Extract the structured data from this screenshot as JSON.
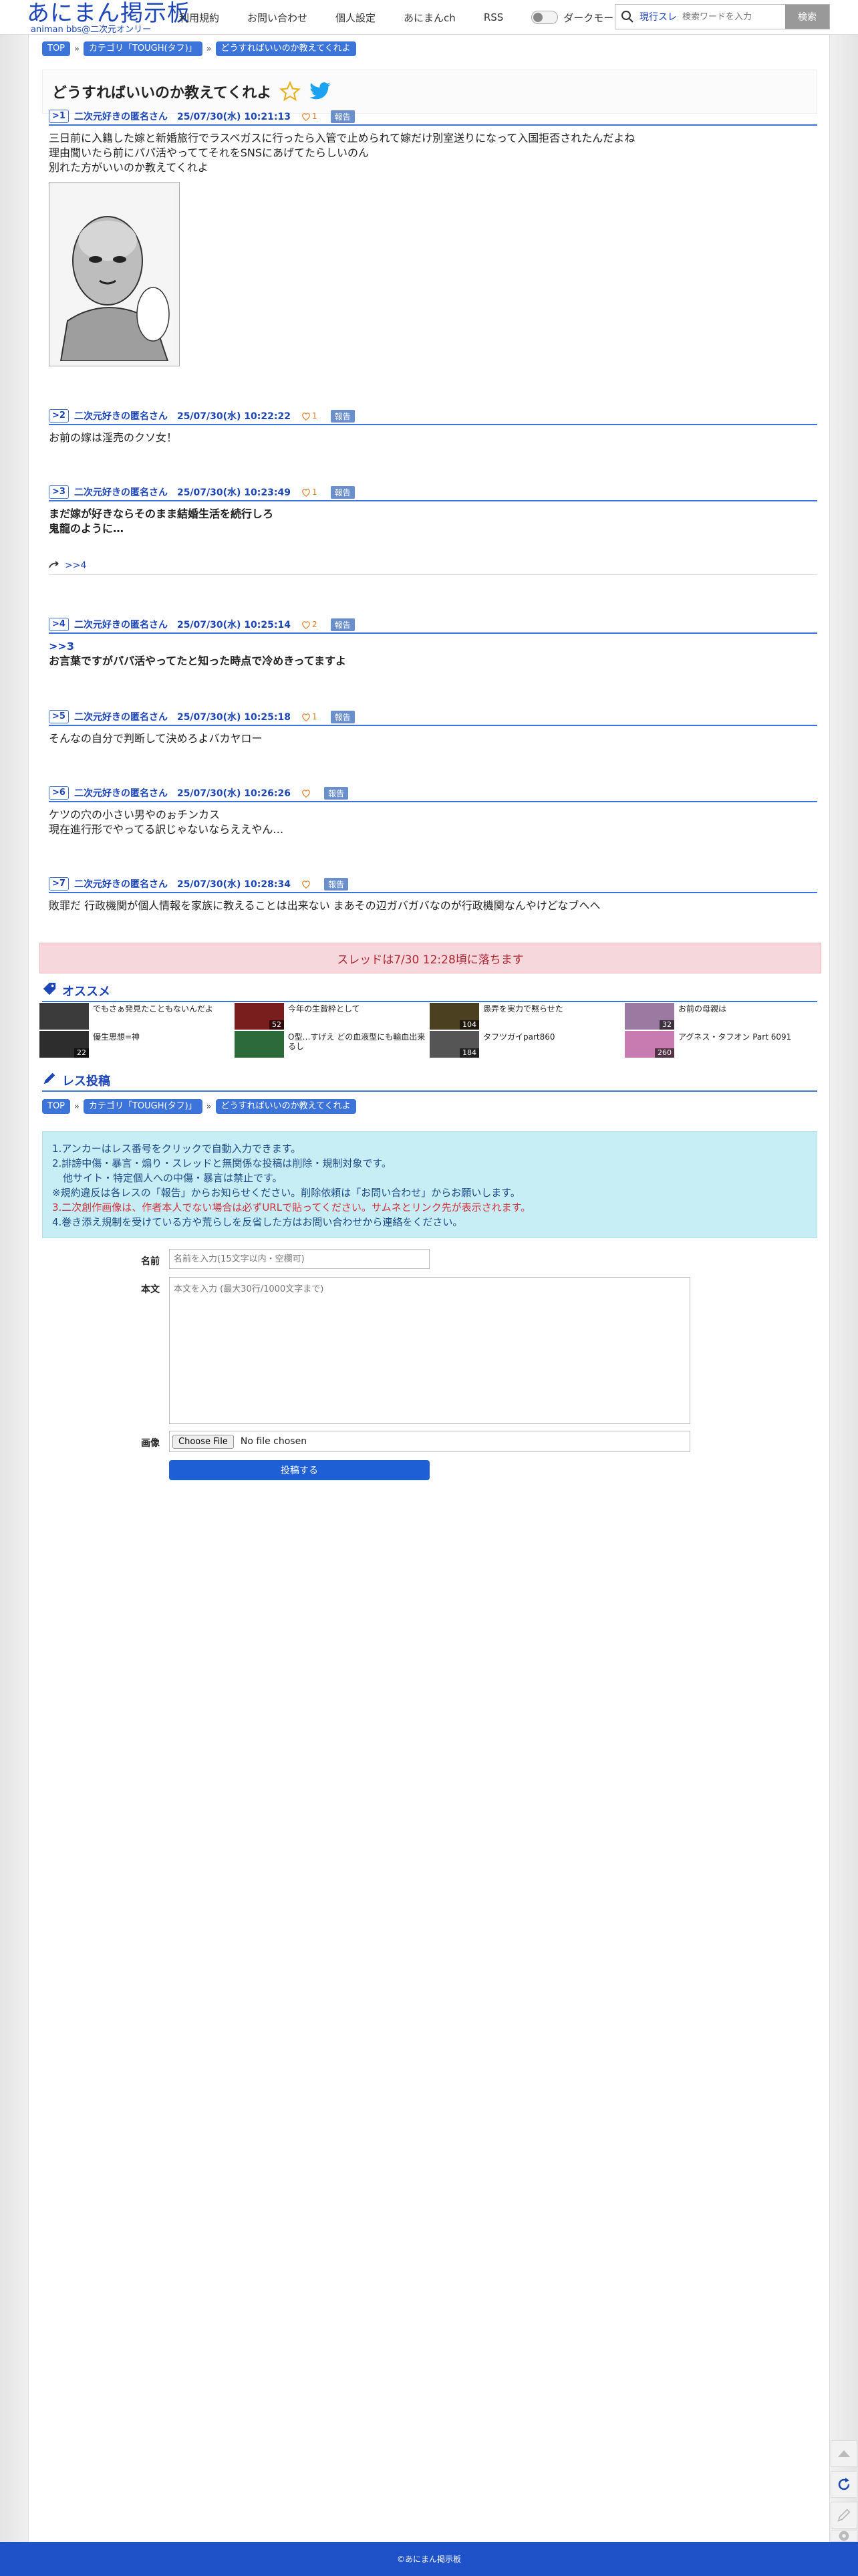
{
  "header": {
    "logo_main": "あにまん掲示板",
    "logo_sub": "animan bbs@二次元オンリー",
    "nav": [
      "利用規約",
      "お問い合わせ",
      "個人設定",
      "あにまんch",
      "RSS"
    ],
    "dark_mode_label": "ダークモード",
    "search_mode": "現行スレ",
    "search_placeholder": "検索ワードを入力",
    "search_button": "検索"
  },
  "breadcrumb": [
    "TOP",
    "カテゴリ「TOUGH(タフ)」",
    "どうすればいいのか教えてくれよ"
  ],
  "thread": {
    "title": "どうすればいいのか教えてくれよ"
  },
  "posts": [
    {
      "num": "1",
      "name": "二次元好きの匿名さん",
      "date": "25/07/30(水) 10:21:13",
      "likes": "1",
      "report": "報告",
      "lines": [
        "三日前に入籍した嫁と新婚旅行でラスベガスに行ったら入管で止められて嫁だけ別室送りになって入国拒否されたんだよね",
        "理由聞いたら前にパパ活やっててそれをSNSにあげてたらしいのん",
        "別れた方がいいのか教えてくれよ"
      ]
    },
    {
      "num": "2",
      "name": "二次元好きの匿名さん",
      "date": "25/07/30(水) 10:22:22",
      "likes": "1",
      "report": "報告",
      "lines": [
        "お前の嫁は淫売のクソ女！"
      ]
    },
    {
      "num": "3",
      "name": "二次元好きの匿名さん",
      "date": "25/07/30(水) 10:23:49",
      "likes": "1",
      "report": "報告",
      "lines": [
        "まだ嫁が好きならそのまま結婚生活を続行しろ",
        "鬼龍のように…"
      ],
      "reply": ">>4"
    },
    {
      "num": "4",
      "name": "二次元好きの匿名さん",
      "date": "25/07/30(水) 10:25:14",
      "likes": "2",
      "report": "報告",
      "anchor": ">>3",
      "lines": [
        "お言葉ですがパパ活やってたと知った時点で冷めきってますよ"
      ]
    },
    {
      "num": "5",
      "name": "二次元好きの匿名さん",
      "date": "25/07/30(水) 10:25:18",
      "likes": "1",
      "report": "報告",
      "lines": [
        "そんなの自分で判断して決めろよバカヤロー"
      ]
    },
    {
      "num": "6",
      "name": "二次元好きの匿名さん",
      "date": "25/07/30(水) 10:26:26",
      "likes": "",
      "report": "報告",
      "lines": [
        "ケツの穴の小さい男やのぉチンカス",
        "現在進行形でやってる訳じゃないならええやん…"
      ]
    },
    {
      "num": "7",
      "name": "二次元好きの匿名さん",
      "date": "25/07/30(水) 10:28:34",
      "likes": "",
      "report": "報告",
      "lines": [
        "敗罪だ 行政機関が個人情報を家族に教えることは出来ない まあその辺ガバガバなのが行政機関なんやけどなブヘヘ"
      ]
    }
  ],
  "expired_notice": "スレッドは7/30 12:28頃に落ちます",
  "recommend": {
    "title": "オススメ",
    "items": [
      {
        "title": "でもさぁ発見たこともないんだよ",
        "count": "",
        "color": "#3b3b3b"
      },
      {
        "title": "今年の生贄枠として",
        "count": "52",
        "color": "#7a1d1d"
      },
      {
        "title": "愚弄を実力で黙らせた",
        "count": "104",
        "color": "#4b4020"
      },
      {
        "title": "お前の母親は",
        "count": "32",
        "color": "#9a7aa0"
      },
      {
        "title": "優生思想=神",
        "count": "22",
        "color": "#2d2d2d"
      },
      {
        "title": "O型…すげえ どの血液型にも輸血出来るし",
        "count": "",
        "color": "#2c6a3a"
      },
      {
        "title": "タフツガイpart860",
        "count": "184",
        "color": "#555555"
      },
      {
        "title": "アグネス・タフオン Part 6091",
        "count": "260",
        "color": "#c77bb0"
      }
    ]
  },
  "reply_form": {
    "title": "レス投稿",
    "rules": [
      "1.アンカーはレス番号をクリックで自動入力できます。",
      "2.誹謗中傷・暴言・煽り・スレッドと無関係な投稿は削除・規制対象です。",
      "他サイト・特定個人への中傷・暴言は禁止です。",
      "※規約違反は各レスの「報告」からお知らせください。削除依頼は「お問い合わせ」からお願いします。",
      "3.二次創作画像は、作者本人でない場合は必ずURLで貼ってください。サムネとリンク先が表示されます。",
      "4.巻き添え規制を受けている方や荒らしを反省した方はお問い合わせから連絡をください。"
    ],
    "name_label": "名前",
    "name_placeholder": "名前を入力(15文字以内・空欄可)",
    "body_label": "本文",
    "body_placeholder": "本文を入力 (最大30行/1000文字まで)",
    "image_label": "画像",
    "file_button": "Choose File",
    "file_status": "No file chosen",
    "submit": "投稿する"
  },
  "footer": "©あにまん掲示板",
  "colors": {
    "accent": "#1c46b8",
    "badge": "#3d74d9",
    "footer": "#1f51c9"
  }
}
